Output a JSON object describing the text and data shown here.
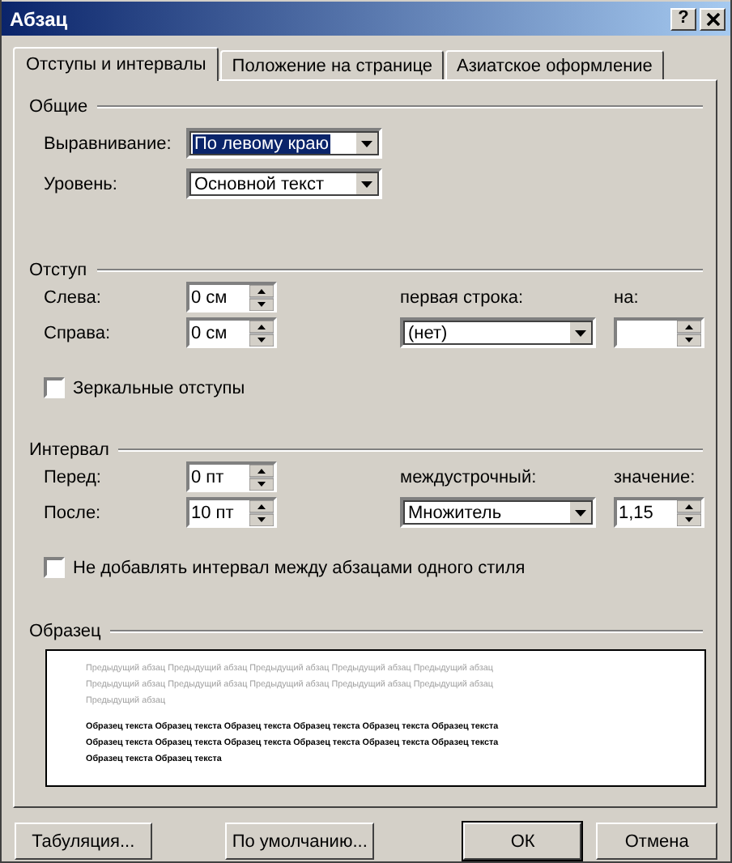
{
  "window": {
    "title": "Абзац",
    "help_button": "?"
  },
  "tabs": [
    {
      "label": "Отступы и интервалы",
      "selected": true
    },
    {
      "label": "Положение на странице",
      "selected": false
    },
    {
      "label": "Азиатское оформление",
      "selected": false
    }
  ],
  "general": {
    "title": "Общие",
    "fields": [
      {
        "label": "Выравнивание:",
        "value": "По левому краю",
        "focused": true
      },
      {
        "label": "Уровень:",
        "value": "Основной текст",
        "focused": false
      }
    ]
  },
  "indent": {
    "title": "Отступ",
    "left": {
      "label": "Слева:",
      "value": "0 см"
    },
    "right": {
      "label": "Справа:",
      "value": "0 см"
    },
    "first_line": {
      "label": "первая строка:",
      "value": "(нет)"
    },
    "by": {
      "label": "на:"
    },
    "mirror": {
      "label": "Зеркальные отступы",
      "checked": false
    }
  },
  "spacing": {
    "title": "Интервал",
    "before": {
      "label": "Перед:",
      "value": "0 пт"
    },
    "after": {
      "label": "После:",
      "value": "10 пт"
    },
    "line_spacing": {
      "label": "междустрочный:",
      "value": "Множитель"
    },
    "at": {
      "label": "значение:",
      "value": "1,15"
    },
    "no_space": {
      "label": "Не добавлять интервал между абзацами одного стиля",
      "checked": false
    }
  },
  "preview": {
    "title": "Образец",
    "previous_lines": [
      "Предыдущий абзац Предыдущий абзац Предыдущий абзац Предыдущий абзац Предыдущий абзац",
      "Предыдущий абзац Предыдущий абзац Предыдущий абзац Предыдущий абзац Предыдущий абзац",
      "Предыдущий абзац"
    ],
    "sample_lines": [
      "Образец текста Образец текста Образец текста Образец текста Образец текста Образец текста",
      "Образец текста Образец текста Образец текста Образец текста Образец текста Образец текста",
      "Образец текста Образец текста"
    ]
  },
  "buttons": [
    {
      "label": "Табуляция...",
      "default": false
    },
    {
      "label": "По умолчанию...",
      "default": false
    },
    {
      "label": "ОК",
      "default": true
    },
    {
      "label": "Отмена",
      "default": false
    }
  ]
}
